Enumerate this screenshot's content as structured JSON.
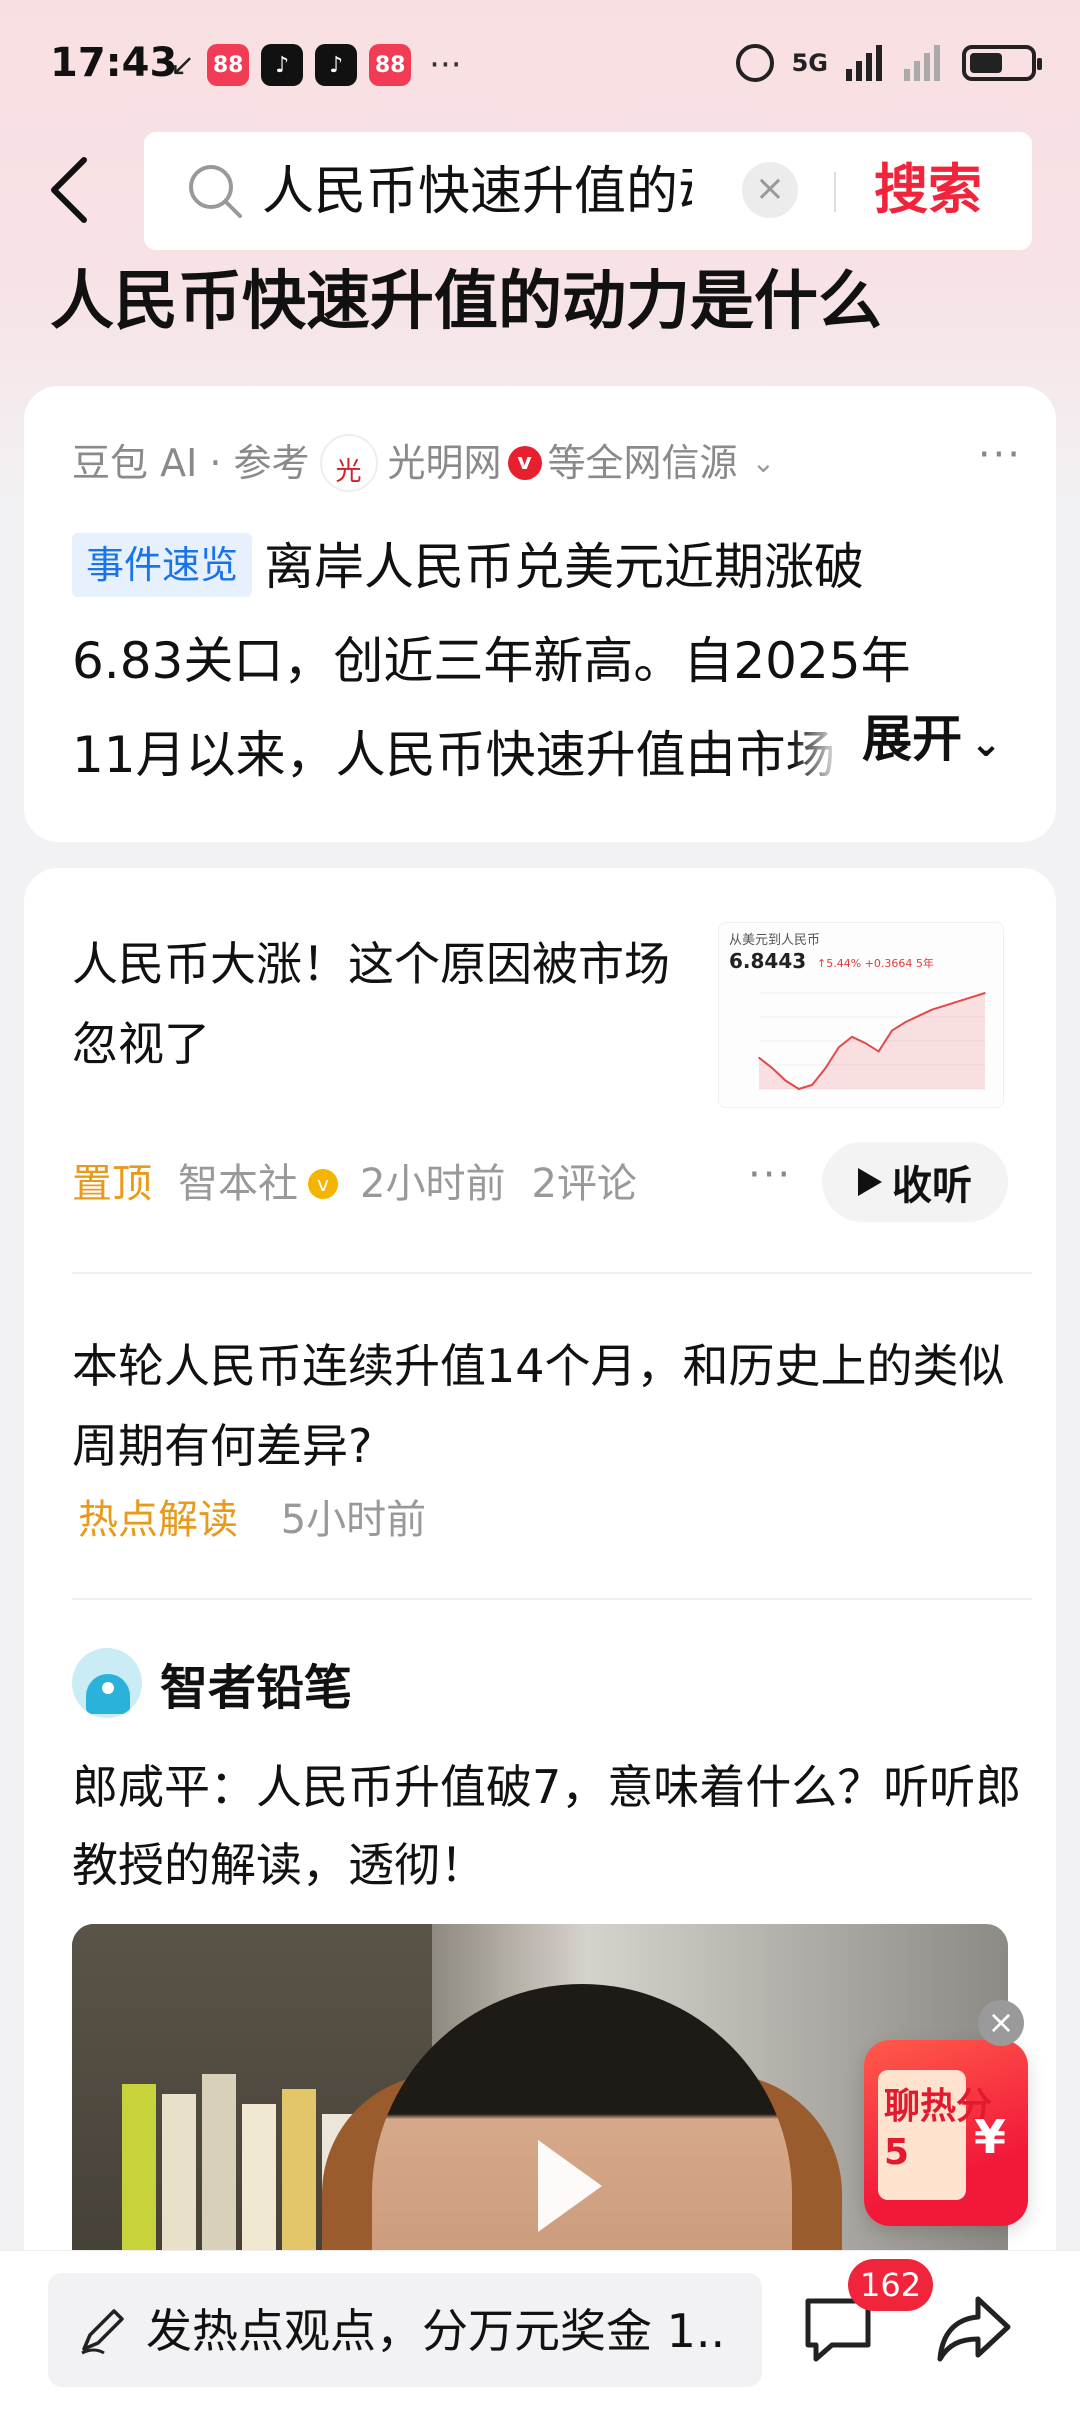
{
  "status_bar": {
    "time": "17:43",
    "signal_text": "5G",
    "dots": "···"
  },
  "header": {
    "search_query": "人民币快速升值的动",
    "search_button": "搜索"
  },
  "page_title": "人民币快速升值的动力是什么",
  "ai_summary": {
    "source_prefix": "豆包 AI · 参考",
    "source_name": "光明网",
    "source_suffix": "等全网信源",
    "tag": "事件速览",
    "line1": "离岸人民币兑美元近期涨破",
    "line2": "6.83关口，创近三年新高。自2025年",
    "line3": "11月以来，人民币快速升值由市场",
    "expand_label": "展开"
  },
  "feed": {
    "item1": {
      "title": "人民币大涨！这个原因被市场忽视了",
      "thumb_label": "从美元到人民币",
      "thumb_price": "6.8443",
      "thumb_change": "↑5.44% +0.3664 5年",
      "pin_label": "置顶",
      "source": "智本社",
      "time": "2小时前",
      "comments": "2评论",
      "listen_label": "收听"
    },
    "item2": {
      "title": "本轮人民币连续升值14个月，和历史上的类似周期有何差异?",
      "tag": "热点解读",
      "time": "5小时前"
    },
    "item3": {
      "author": "智者铅笔",
      "title": "郎咸平：人民币升值破7，意味着什么？听听郎教授的解读，透彻！"
    }
  },
  "promo": {
    "text": "聊热分5",
    "yen": "¥",
    "close": "×"
  },
  "bottom_bar": {
    "comment_placeholder": "发热点观点，分万元奖金 1..",
    "comment_count": "162"
  },
  "chart_data": {
    "type": "line",
    "title": "从美元到人民币",
    "series": [
      {
        "values": [
          7.15,
          7.2,
          7.26,
          7.3,
          7.28,
          7.2,
          7.1,
          7.05,
          7.08,
          7.12,
          7.02,
          6.98,
          6.95,
          6.92,
          6.9,
          6.88,
          6.86,
          6.84
        ]
      }
    ]
  },
  "colors": {
    "accent_red": "#f0243a",
    "tag_blue": "#1a73e8",
    "pin_orange": "#e99a1a"
  }
}
